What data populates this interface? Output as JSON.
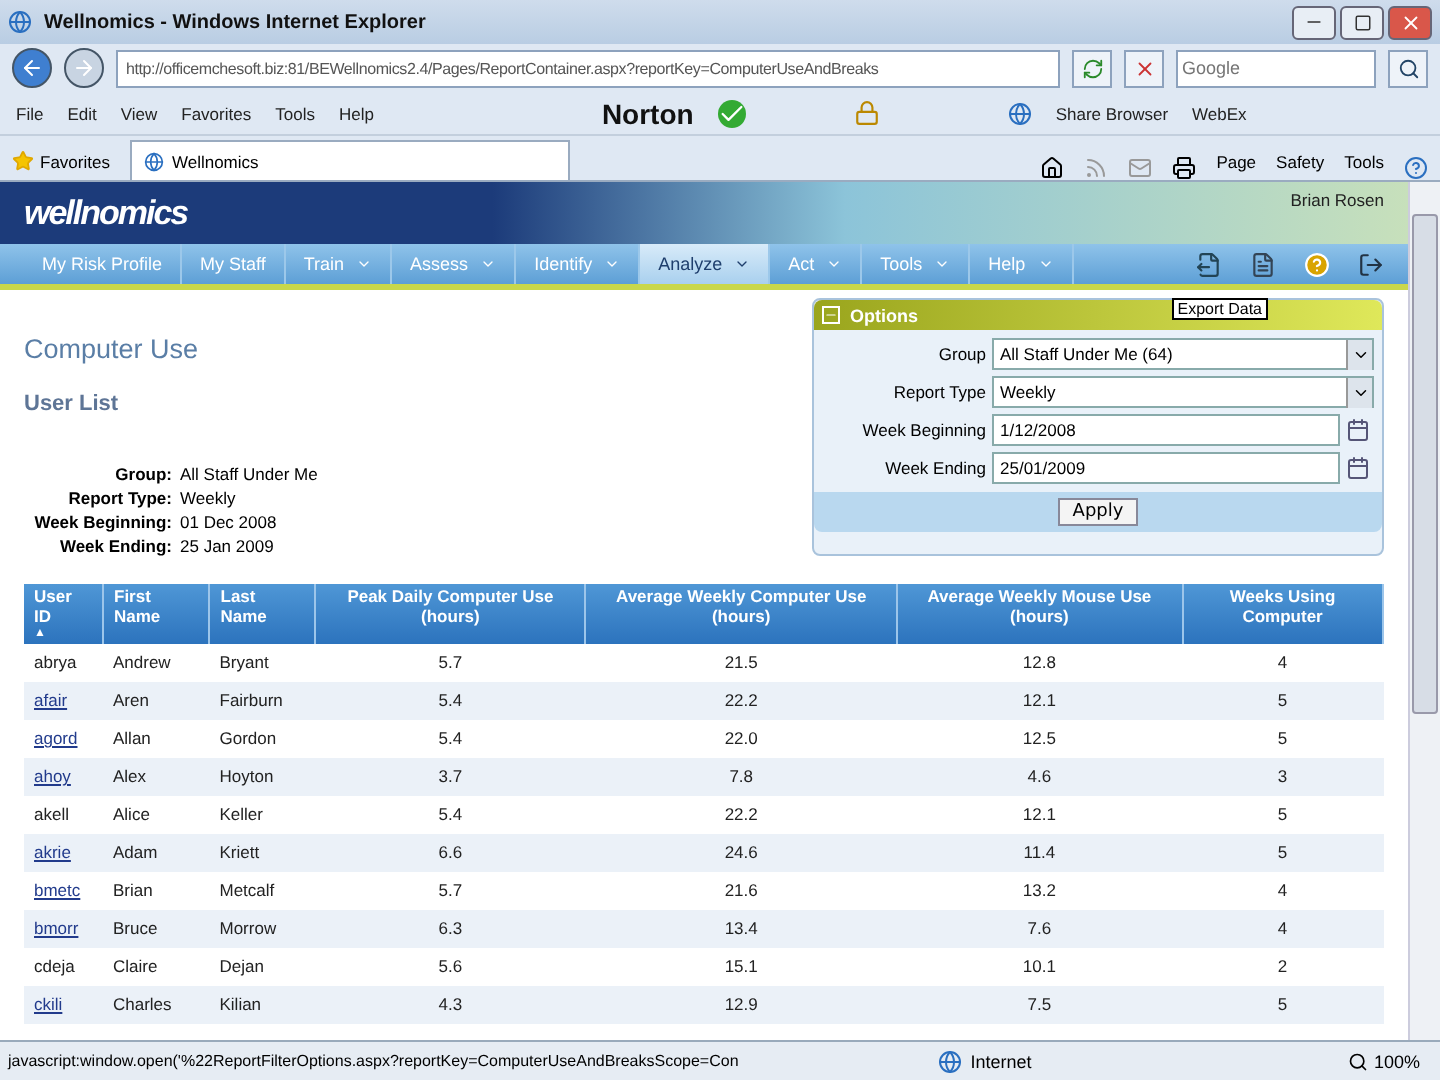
{
  "window": {
    "title": "Wellnomics - Windows Internet Explorer"
  },
  "address_bar": {
    "url": "http://officemchesoft.biz:81/BEWellnomics2.4/Pages/ReportContainer.aspx?reportKey=ComputerUseAndBreaks",
    "search_placeholder": "Google"
  },
  "menu": [
    "File",
    "Edit",
    "View",
    "Favorites",
    "Tools",
    "Help"
  ],
  "toolbar": {
    "norton": "Norton",
    "share": "Share Browser",
    "webex": "WebEx"
  },
  "favorites": {
    "label": "Favorites",
    "tab": "Wellnomics"
  },
  "command_bar": [
    "Page",
    "Safety",
    "Tools"
  ],
  "header": {
    "logo": "wellnomics",
    "user": "Brian Rosen"
  },
  "nav": [
    {
      "label": "My Risk Profile",
      "dropdown": false,
      "selected": false
    },
    {
      "label": "My Staff",
      "dropdown": false,
      "selected": false
    },
    {
      "label": "Train",
      "dropdown": true,
      "selected": false
    },
    {
      "label": "Assess",
      "dropdown": true,
      "selected": false
    },
    {
      "label": "Identify",
      "dropdown": true,
      "selected": false
    },
    {
      "label": "Analyze",
      "dropdown": true,
      "selected": true
    },
    {
      "label": "Act",
      "dropdown": true,
      "selected": false
    },
    {
      "label": "Tools",
      "dropdown": true,
      "selected": false
    },
    {
      "label": "Help",
      "dropdown": true,
      "selected": false
    }
  ],
  "tooltip": "Export Data",
  "heading": "Computer Use",
  "subheading": "User List",
  "summary": [
    {
      "label": "Group:",
      "value": "All Staff Under Me"
    },
    {
      "label": "Report Type:",
      "value": "Weekly"
    },
    {
      "label": "Week Beginning:",
      "value": "01 Dec 2008"
    },
    {
      "label": "Week Ending:",
      "value": "25 Jan 2009"
    }
  ],
  "options": {
    "title": "Options",
    "expanded": true,
    "button": "Apply",
    "fields": [
      {
        "kind": "select",
        "label": "Group",
        "value": "All Staff Under Me (64)"
      },
      {
        "kind": "select",
        "label": "Report Type",
        "value": "Weekly"
      },
      {
        "kind": "date",
        "label": "Week Beginning",
        "value": "1/12/2008"
      },
      {
        "kind": "date",
        "label": "Week Ending",
        "value": "25/01/2009"
      }
    ]
  },
  "table": {
    "sort_indicator": "▲",
    "columns": [
      {
        "label": "User ID",
        "sorted": true
      },
      {
        "label": "First Name",
        "sorted": false
      },
      {
        "label": "Last Name",
        "sorted": false
      },
      {
        "label": "Peak Daily Computer Use (hours)",
        "sorted": false
      },
      {
        "label": "Average Weekly Computer Use (hours)",
        "sorted": false
      },
      {
        "label": "Average Weekly Mouse Use (hours)",
        "sorted": false
      },
      {
        "label": "Weeks Using Computer",
        "sorted": false
      }
    ],
    "rows": [
      {
        "cells": [
          "abrya",
          "Andrew",
          "Bryant",
          "5.7",
          "21.5",
          "12.8",
          "4"
        ],
        "linked": false
      },
      {
        "cells": [
          "afair",
          "Aren",
          "Fairburn",
          "5.4",
          "22.2",
          "12.1",
          "5"
        ],
        "linked": true
      },
      {
        "cells": [
          "agord",
          "Allan",
          "Gordon",
          "5.4",
          "22.0",
          "12.5",
          "5"
        ],
        "linked": true
      },
      {
        "cells": [
          "ahoy",
          "Alex",
          "Hoyton",
          "3.7",
          "7.8",
          "4.6",
          "3"
        ],
        "linked": true
      },
      {
        "cells": [
          "akell",
          "Alice",
          "Keller",
          "5.4",
          "22.2",
          "12.1",
          "5"
        ],
        "linked": false
      },
      {
        "cells": [
          "akrie",
          "Adam",
          "Kriett",
          "6.6",
          "24.6",
          "11.4",
          "5"
        ],
        "linked": true
      },
      {
        "cells": [
          "bmetc",
          "Brian",
          "Metcalf",
          "5.7",
          "21.6",
          "13.2",
          "4"
        ],
        "linked": true
      },
      {
        "cells": [
          "bmorr",
          "Bruce",
          "Morrow",
          "6.3",
          "13.4",
          "7.6",
          "4"
        ],
        "linked": true
      },
      {
        "cells": [
          "cdeja",
          "Claire",
          "Dejan",
          "5.6",
          "15.1",
          "10.1",
          "2"
        ],
        "linked": false
      },
      {
        "cells": [
          "ckili",
          "Charles",
          "Kilian",
          "4.3",
          "12.9",
          "7.5",
          "5"
        ],
        "linked": true
      }
    ]
  },
  "status_bar": {
    "text": "javascript:window.open('%22ReportFilterOptions.aspx?reportKey=ComputerUseAndBreaksScope=Con",
    "zone": "Internet",
    "zoom": "100%"
  }
}
